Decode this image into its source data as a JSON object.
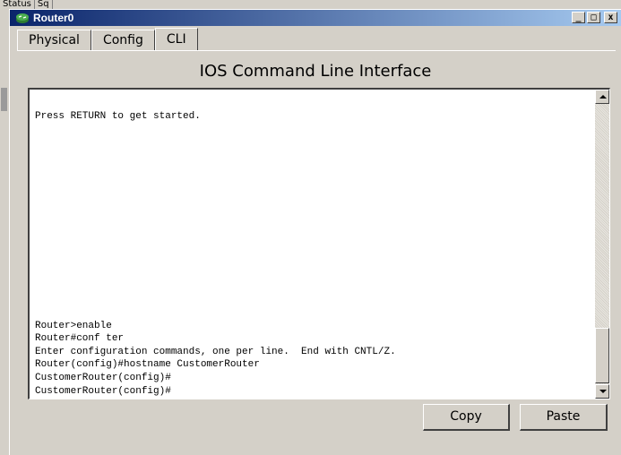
{
  "background_app": {
    "tabs": [
      "Status",
      "Sq"
    ]
  },
  "window": {
    "title": "Router0",
    "controls": {
      "minimize": "_",
      "maximize": "□",
      "close": "x"
    },
    "tabs": [
      {
        "label": "Physical",
        "active": false
      },
      {
        "label": "Config",
        "active": false
      },
      {
        "label": "CLI",
        "active": true
      }
    ],
    "heading": "IOS Command Line Interface",
    "terminal": {
      "lines": [
        "Press RETURN to get started.",
        "Router>enable",
        "Router#conf ter",
        "Enter configuration commands, one per line.  End with CNTL/Z.",
        "Router(config)#hostname CustomerRouter",
        "CustomerRouter(config)#",
        "CustomerRouter(config)#"
      ]
    },
    "buttons": {
      "copy": "Copy",
      "paste": "Paste"
    }
  },
  "colors": {
    "title_gradient_start": "#0a246a",
    "title_gradient_end": "#a6caf0",
    "face": "#d4d0c8"
  },
  "icons": {
    "title_icon": "router-icon"
  }
}
